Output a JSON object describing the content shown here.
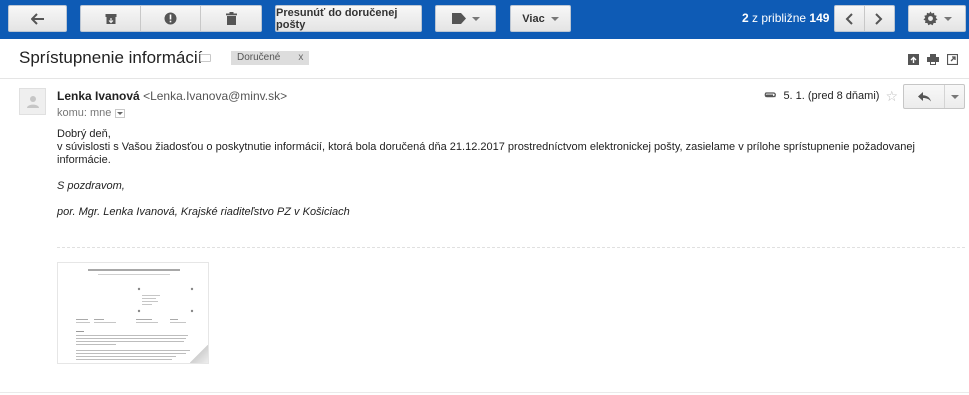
{
  "toolbar": {
    "move_to_inbox_label": "Presunúť do doručenej pošty",
    "more_label": "Viac",
    "pager_bold": "2",
    "pager_rest": "z približne",
    "pager_total": "149"
  },
  "message": {
    "subject": "Sprístupnenie informácií",
    "label_chip": "Doručené",
    "label_chip_remove": "x",
    "sender_name": "Lenka Ivanová",
    "sender_email": "<Lenka.Ivanova@minv.sk>",
    "recipient": "komu: mne",
    "date": "5. 1. (pred 8 dňami)",
    "body": {
      "greeting": "Dobrý deň,",
      "paragraph": "v súvislosti s Vašou žiadosťou o poskytnutie informácií, ktorá bola doručená dňa 21.12.2017 prostredníctvom elektronickej pošty, zasielame v prílohe sprístupnenie požadovanej informácie.",
      "closing": "S pozdravom,",
      "signature": "por. Mgr. Lenka Ivanová, Krajské riaditeľstvo PZ v Košiciach"
    }
  },
  "colors": {
    "toolbar_bg": "#0e5bb5",
    "chip_bg": "#dddddd"
  },
  "icons": {
    "back": "arrow-left-icon",
    "archive": "archive-icon",
    "spam": "exclamation-icon",
    "delete": "trash-icon",
    "labels": "tag-icon",
    "prev": "chevron-left-icon",
    "next": "chevron-right-icon",
    "settings": "gear-icon",
    "attachment": "paperclip-icon",
    "star": "star-icon",
    "reply": "reply-icon"
  }
}
